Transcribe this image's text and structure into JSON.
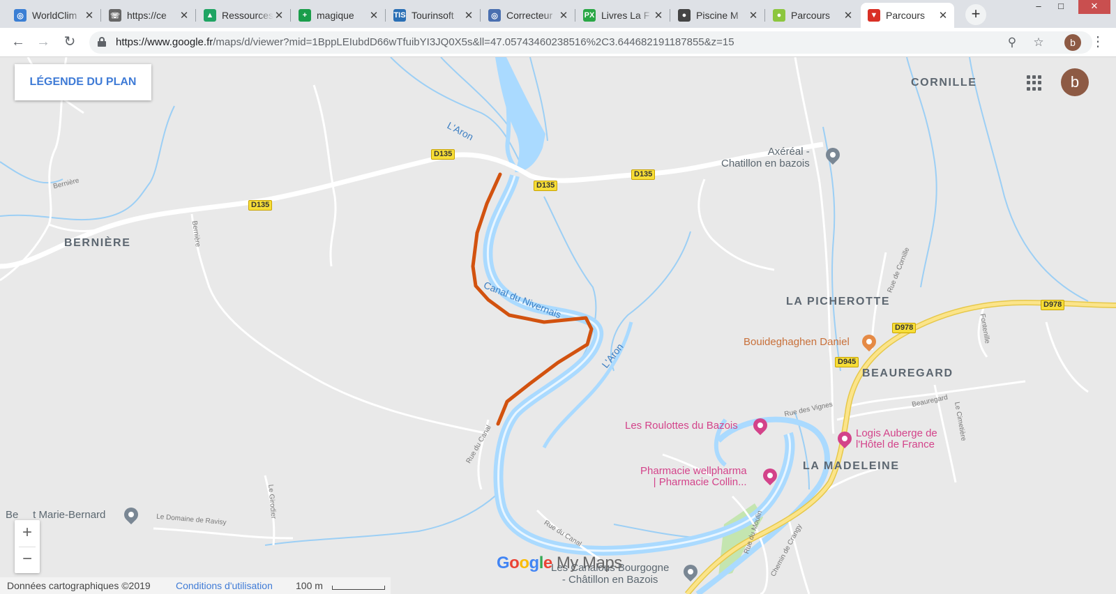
{
  "browser": {
    "tabs": [
      {
        "title": "WorldClim",
        "color": "#3b7fd4",
        "glyph": "◎"
      },
      {
        "title": "https://ce",
        "color": "#666666",
        "glyph": "☏"
      },
      {
        "title": "Ressources",
        "color": "#1fa463",
        "glyph": "▲"
      },
      {
        "title": "magique",
        "color": "#1a9d4a",
        "glyph": "+"
      },
      {
        "title": "Tourinsoft",
        "color": "#2a6fb5",
        "glyph": "TIS"
      },
      {
        "title": "Correcteur",
        "color": "#4a6fb0",
        "glyph": "◎"
      },
      {
        "title": "Livres La F",
        "color": "#29a745",
        "glyph": "PX"
      },
      {
        "title": "Piscine M",
        "color": "#444444",
        "glyph": "●"
      },
      {
        "title": "Parcours",
        "color": "#8cc63e",
        "glyph": "●"
      },
      {
        "title": "Parcours",
        "color": "#d93025",
        "glyph": "▼"
      }
    ],
    "active_tab": 9,
    "close_glyph": "✕",
    "new_tab_glyph": "+",
    "window_controls": {
      "minimize": "–",
      "maximize": "□",
      "close": "✕"
    },
    "url_host": "https://www.google.fr",
    "url_path": "/maps/d/viewer?mid=1BppLEIubdD66wTfuibYI3JQ0X5s&ll=47.05743460238516%2C3.644682191187855&z=15",
    "profile_initial": "b",
    "icons": [
      "back-icon",
      "forward-icon",
      "reload-icon",
      "lock-icon",
      "zoom-page-icon",
      "star-icon",
      "menu-dots-icon"
    ]
  },
  "map": {
    "legend_button": "LÉGENDE DU PLAN",
    "account_initial": "b",
    "zoom_in": "+",
    "zoom_out": "−",
    "brand_google": "Google",
    "brand_mymaps": " My Maps",
    "attribution": "Données cartographiques ©2019",
    "terms_link": "Conditions d'utilisation",
    "scale_text": "100 m",
    "places": {
      "cornille": "CORNILLE",
      "berniere": "BERNIÈRE",
      "la_picherotte": "LA PICHEROTTE",
      "beauregard": "BEAUREGARD",
      "la_madeleine": "LA MADELEINE"
    },
    "waterways": {
      "aron_north": "L'Aron",
      "canal": "Canal du Nivernais",
      "aron_south": "L'Aron"
    },
    "road_shields": {
      "d135_a": "D135",
      "d135_b": "D135",
      "d135_c": "D135",
      "d135_d": "D135",
      "d978_a": "D978",
      "d978_b": "D978",
      "d945": "D945"
    },
    "streets": {
      "berniere_1": "Bernière",
      "berniere_2": "Bernière",
      "rue_du_canal_1": "Rue du Canal",
      "rue_du_canal_2": "Rue du Canal",
      "le_girodier": "Le Girodier",
      "domaine_ravisy": "Le Domaine de Ravisy",
      "rue_des_vignes": "Rue des Vignes",
      "beauregard_st": "Beauregard",
      "rue_de_cornille": "Rue de Cornille",
      "fontenille": "Fontenille",
      "le_cimetiere": "Le Cimetière",
      "rue_du_moulin": "Rue du Moulin",
      "chemin_de_crangy": "Chemin de Crangy"
    },
    "pois": {
      "axereal": "Axéréal -",
      "axereal_2": "Chatillon en bazois",
      "bouideghaghen": "Bouideghaghen Daniel",
      "roulottes": "Les Roulottes du Bazois",
      "logis_1": "Logis Auberge de",
      "logis_2": "l'Hôtel de France",
      "pharmacie_1": "Pharmacie wellpharma",
      "pharmacie_2": "| Pharmacie Collin...",
      "canalous_1": "Les Canalous Bourgogne",
      "canalous_2": "- Châtillon en Bazois",
      "marie_bernard": "Be     t Marie-Bernard"
    },
    "colors": {
      "route": "#d2520f",
      "water": "#aadaff",
      "water_line": "#8cc8f0",
      "road": "#ffffff",
      "highway": "#f8d767",
      "land": "#e9e9e9",
      "park": "#c4e5b0",
      "poi_pink": "#d3438a",
      "poi_gray": "#7a8794",
      "poi_orange": "#e58a45"
    }
  }
}
